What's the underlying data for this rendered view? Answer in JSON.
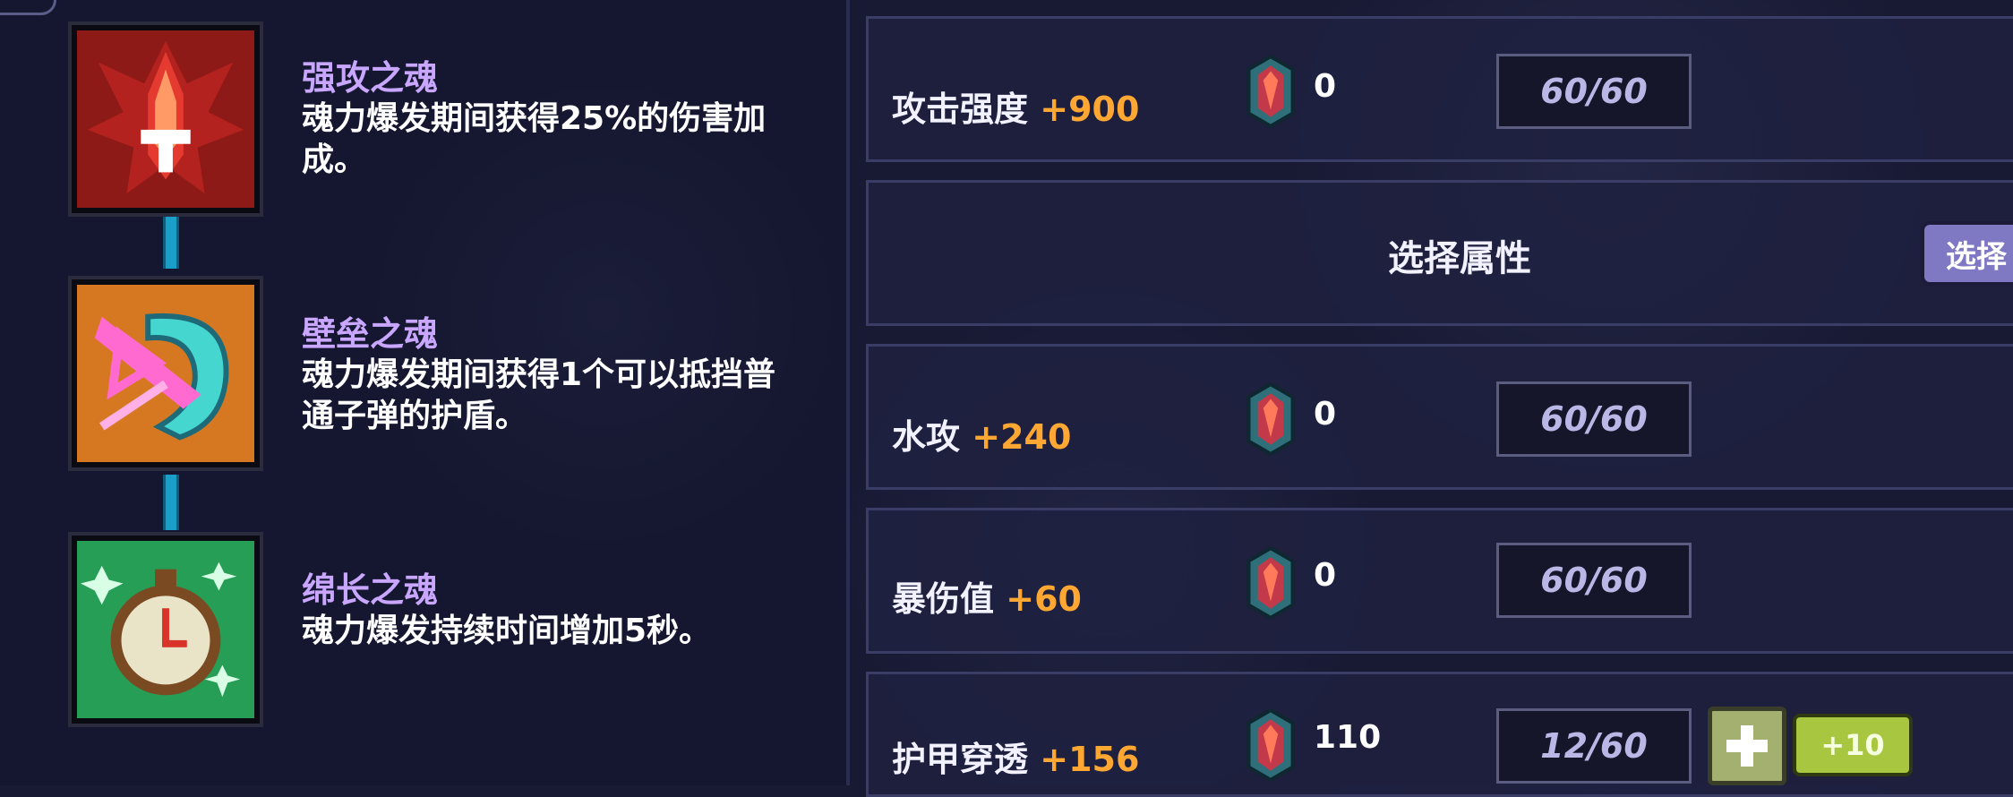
{
  "souls": [
    {
      "name": "强攻之魂",
      "desc": "魂力爆发期间获得25%的伤害加成。",
      "icon": "red-attack-soul-icon"
    },
    {
      "name": "壁垒之魂",
      "desc": "魂力爆发期间获得1个可以抵挡普通子弹的护盾。",
      "icon": "orange-shield-soul-icon"
    },
    {
      "name": "绵长之魂",
      "desc": "魂力爆发持续时间增加5秒。",
      "icon": "green-clock-soul-icon"
    }
  ],
  "attributes": [
    {
      "label": "攻击强度",
      "bonus": "+900",
      "gems": "0",
      "level": "60/60"
    },
    {
      "label": "水攻",
      "bonus": "+240",
      "gems": "0",
      "level": "60/60"
    },
    {
      "label": "暴伤值",
      "bonus": "+60",
      "gems": "0",
      "level": "60/60"
    },
    {
      "label": "护甲穿透",
      "bonus": "+156",
      "gems": "110",
      "level": "12/60"
    }
  ],
  "select_row": {
    "title": "选择属性",
    "button": "选择"
  },
  "upgrade": {
    "plus10_label": "+10"
  },
  "colors": {
    "soul_name": "#c9a6ff",
    "bonus": "#ffa733",
    "accent_button": "#7f78c2",
    "upgrade_button": "#a9c640"
  }
}
